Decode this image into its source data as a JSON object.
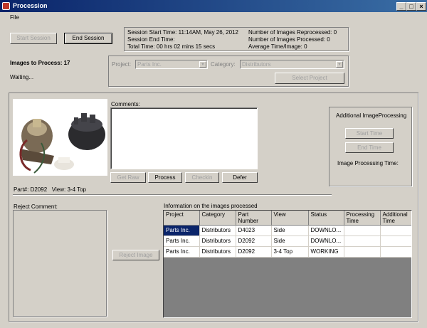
{
  "window": {
    "title": "Procession"
  },
  "menu": {
    "file": "File"
  },
  "controls": {
    "start_session": "Start Session",
    "end_session": "End Session"
  },
  "session": {
    "start": "Session Start Time: 11:14AM, May 26, 2012",
    "end": "Session End Time:",
    "total": "Total Time: 00 hrs 02 mins 15 secs",
    "reprocessed": "Number of Images Reprocessed: 0",
    "processed": "Number of Images Processed: 0",
    "average": "Average Time/Image: 0"
  },
  "queue": {
    "title": "Images to Process: 17",
    "status": "Waiting..."
  },
  "project": {
    "project_label": "Project:",
    "project_value": "Parts Inc.",
    "category_label": "Category:",
    "category_value": "Distributors",
    "select_button": "Select Project"
  },
  "comments": {
    "label": "Comments:"
  },
  "actions": {
    "get_raw": "Get Raw",
    "process": "Process",
    "checkin": "Checkin",
    "defer": "Defer"
  },
  "part": {
    "info": "Part#: D2092   View: 3-4 Top"
  },
  "additional": {
    "title": "Additional ImageProcessing",
    "start_time": "Start Time",
    "end_time": "End Time",
    "processing_time": "Image Processing Time:"
  },
  "reject": {
    "label": "Reject Comment:",
    "button": "Reject Image"
  },
  "info_table": {
    "title": "Information on the images processed",
    "columns": [
      "Project",
      "Category",
      "Part\nNumber",
      "View",
      "Status",
      "Processing\nTime",
      "Additional\nTime"
    ],
    "rows": [
      [
        "Parts Inc.",
        "Distributors",
        "D4023",
        "Side",
        "DOWNLO...",
        "",
        ""
      ],
      [
        "Parts Inc.",
        "Distributors",
        "D2092",
        "Side",
        "DOWNLO...",
        "",
        ""
      ],
      [
        "Parts Inc.",
        "Distributors",
        "D2092",
        "3-4 Top",
        "WORKING",
        "",
        ""
      ]
    ]
  }
}
